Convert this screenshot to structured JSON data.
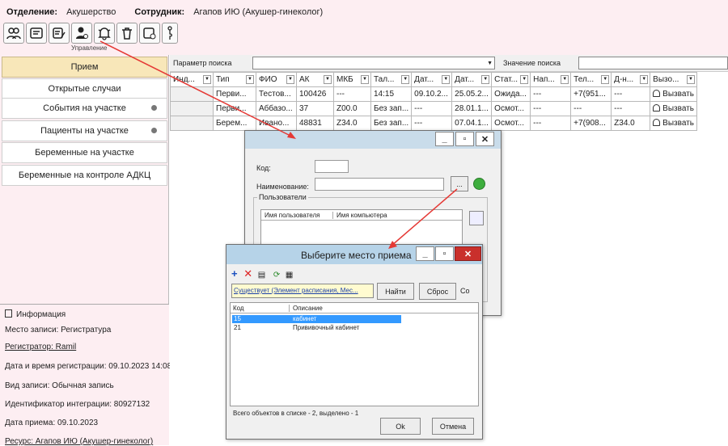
{
  "header": {
    "department_label": "Отделение:",
    "department_value": "Акушерство",
    "employee_label": "Сотрудник:",
    "employee_value": "Агапов ИЮ (Акушер-гинеколог)",
    "toolbar_group": "Управление"
  },
  "sidebar": {
    "items": [
      {
        "label": "Прием"
      },
      {
        "label": "Открытые случаи"
      },
      {
        "label": "События на участке"
      },
      {
        "label": "Пациенты на участке"
      },
      {
        "label": "Беременные на участке"
      },
      {
        "label": "Беременные на контроле АДКЦ"
      }
    ]
  },
  "info": {
    "title": "Информация",
    "place": "Место записи: Регистратура",
    "registrar": "Регистратор: Ramil",
    "reg_datetime": "Дата и время регистрации: 09.10.2023 14:08",
    "record_type": "Вид записи: Обычная запись",
    "integration_id": "Идентификатор интеграции: 80927132",
    "visit_date": "Дата приема: 09.10.2023",
    "resource": "Ресурс: Агапов ИЮ (Акушер-гинеколог)"
  },
  "search": {
    "param_label": "Параметр поиска",
    "value_label": "Значение поиска"
  },
  "table": {
    "columns": [
      "Инд...",
      "Тип",
      "ФИО",
      "АК",
      "МКБ",
      "Тал...",
      "Дат...",
      "Дат...",
      "Стат...",
      "Нап...",
      "Тел...",
      "Д-н...",
      "Вызо..."
    ],
    "rows": [
      [
        "",
        "Перви...",
        "Тестов...",
        "100426",
        "---",
        "14:15",
        "09.10.2...",
        "25.05.2...",
        "Ожида...",
        "---",
        "+7(951...",
        "---",
        "Вызвать"
      ],
      [
        "",
        "Перви...",
        "Аббазо...",
        "37",
        "Z00.0",
        "Без зап...",
        "---",
        "28.01.1...",
        "Осмот...",
        "---",
        "---",
        "---",
        "Вызвать"
      ],
      [
        "",
        "Берем...",
        "Ивано...",
        "48831",
        "Z34.0",
        "Без зап...",
        "---",
        "07.04.1...",
        "Осмот...",
        "---",
        "+7(908...",
        "Z34.0",
        "Вызвать"
      ]
    ]
  },
  "dialog1": {
    "code_label": "Код:",
    "name_label": "Наименование:",
    "browse": "...",
    "users_group": "Пользователи",
    "col_user": "Имя пользователя",
    "col_computer": "Имя компьютера"
  },
  "dialog2": {
    "title": "Выберите место приема",
    "filter_text": "Существует (Элемент расписания, Мес...",
    "find": "Найти",
    "reset": "Сброс",
    "extra": "Со",
    "col_code": "Код",
    "col_desc": "Описание",
    "rows": [
      {
        "code": "15",
        "desc": "кабинет"
      },
      {
        "code": "21",
        "desc": "Прививочный кабинет"
      }
    ],
    "status": "Всего объектов в списке - 2, выделено - 1",
    "ok": "Ok",
    "cancel": "Отмена"
  },
  "colors": {
    "accent_arrow": "#e53935",
    "selection": "#3399ff",
    "panel_pink": "#fdeef2"
  }
}
